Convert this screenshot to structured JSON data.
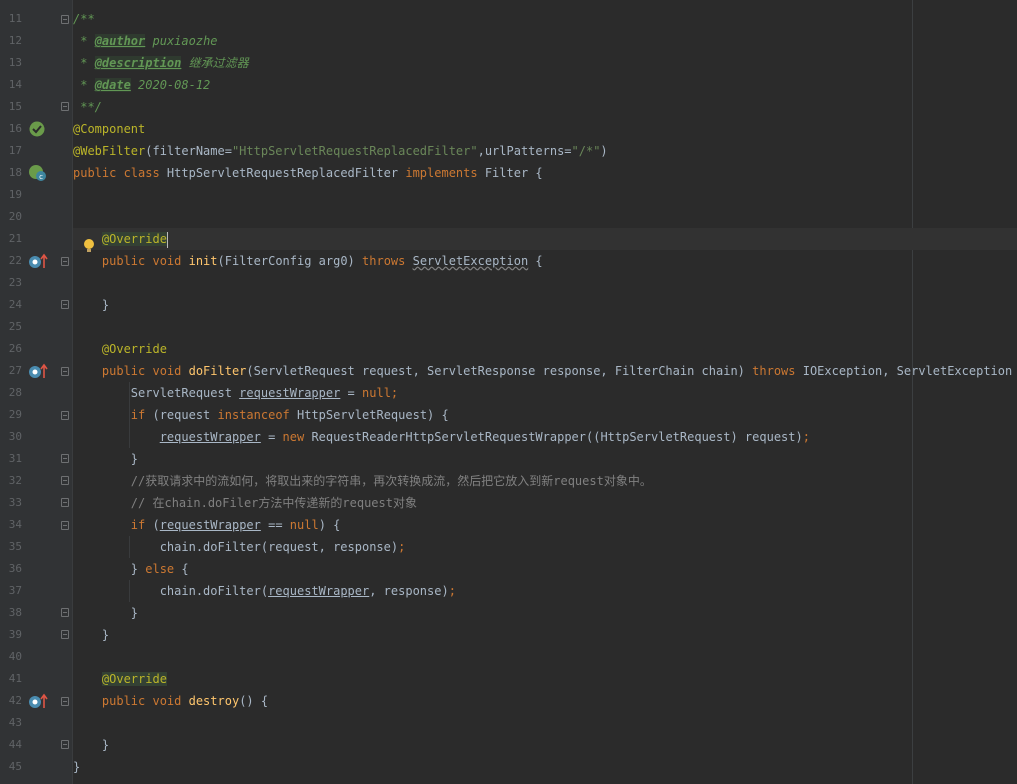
{
  "editor": {
    "lines": [
      {
        "n": "11",
        "t": [
          [
            "doc",
            "/**"
          ]
        ]
      },
      {
        "n": "12",
        "t": [
          [
            "doc",
            " * "
          ],
          [
            "doctag",
            "@author"
          ],
          [
            "doc",
            " puxiaozhe"
          ]
        ]
      },
      {
        "n": "13",
        "t": [
          [
            "doc",
            " * "
          ],
          [
            "doctag",
            "@description"
          ],
          [
            "doc",
            " 继承过滤器"
          ]
        ]
      },
      {
        "n": "14",
        "t": [
          [
            "doc",
            " * "
          ],
          [
            "doctag",
            "@date"
          ],
          [
            "doc",
            " 2020-08-12"
          ]
        ]
      },
      {
        "n": "15",
        "t": [
          [
            "doc",
            " **/"
          ]
        ]
      },
      {
        "n": "16",
        "t": [
          [
            "ann",
            "@Component"
          ]
        ]
      },
      {
        "n": "17",
        "t": [
          [
            "ann",
            "@WebFilter"
          ],
          [
            "plain",
            "(filterName="
          ],
          [
            "str",
            "\"HttpServletRequestReplacedFilter\""
          ],
          [
            "plain",
            ",urlPatterns="
          ],
          [
            "str",
            "\"/*\""
          ],
          [
            "plain",
            ")"
          ]
        ]
      },
      {
        "n": "18",
        "t": [
          [
            "kw",
            "public class "
          ],
          [
            "plain",
            "HttpServletRequestReplacedFilter "
          ],
          [
            "kw",
            "implements "
          ],
          [
            "plain",
            "Filter {"
          ]
        ]
      },
      {
        "n": "19",
        "t": []
      },
      {
        "n": "20",
        "t": []
      },
      {
        "n": "21",
        "t": [
          [
            "plain",
            "    "
          ],
          [
            "ann-hl",
            "@Override"
          ],
          [
            "caret",
            ""
          ]
        ]
      },
      {
        "n": "22",
        "t": [
          [
            "plain",
            "    "
          ],
          [
            "kw",
            "public void "
          ],
          [
            "fn",
            "init"
          ],
          [
            "plain",
            "(FilterConfig arg0) "
          ],
          [
            "kw",
            "throws "
          ],
          [
            "warn",
            "ServletException"
          ],
          [
            "plain",
            " {"
          ]
        ]
      },
      {
        "n": "23",
        "t": []
      },
      {
        "n": "24",
        "t": [
          [
            "plain",
            "    }"
          ]
        ]
      },
      {
        "n": "25",
        "t": []
      },
      {
        "n": "26",
        "t": [
          [
            "plain",
            "    "
          ],
          [
            "ann",
            "@Override"
          ]
        ]
      },
      {
        "n": "27",
        "t": [
          [
            "plain",
            "    "
          ],
          [
            "kw",
            "public void "
          ],
          [
            "fn",
            "doFilter"
          ],
          [
            "plain",
            "(ServletRequest request, ServletResponse response, FilterChain chain) "
          ],
          [
            "kw",
            "throws "
          ],
          [
            "plain",
            "IOException, ServletException {"
          ]
        ]
      },
      {
        "n": "28",
        "t": [
          [
            "plain",
            "        ServletRequest "
          ],
          [
            "var",
            "requestWrapper"
          ],
          [
            "plain",
            " = "
          ],
          [
            "kw",
            "null"
          ],
          [
            "kw",
            ";"
          ]
        ]
      },
      {
        "n": "29",
        "t": [
          [
            "plain",
            "        "
          ],
          [
            "kw",
            "if "
          ],
          [
            "plain",
            "(request "
          ],
          [
            "kw",
            "instanceof "
          ],
          [
            "plain",
            "HttpServletRequest) {"
          ]
        ]
      },
      {
        "n": "30",
        "t": [
          [
            "plain",
            "            "
          ],
          [
            "var",
            "requestWrapper"
          ],
          [
            "plain",
            " = "
          ],
          [
            "kw",
            "new "
          ],
          [
            "plain",
            "RequestReaderHttpServletRequestWrapper((HttpServletRequest) request)"
          ],
          [
            "kw",
            ";"
          ]
        ]
      },
      {
        "n": "31",
        "t": [
          [
            "plain",
            "        }"
          ]
        ]
      },
      {
        "n": "32",
        "t": [
          [
            "plain",
            "        "
          ],
          [
            "cmt",
            "//获取请求中的流如何，将取出来的字符串，再次转换成流，然后把它放入到新request对象中。"
          ]
        ]
      },
      {
        "n": "33",
        "t": [
          [
            "plain",
            "        "
          ],
          [
            "cmt",
            "// 在chain.doFiler方法中传递新的request对象"
          ]
        ]
      },
      {
        "n": "34",
        "t": [
          [
            "plain",
            "        "
          ],
          [
            "kw",
            "if "
          ],
          [
            "plain",
            "("
          ],
          [
            "var",
            "requestWrapper"
          ],
          [
            "plain",
            " == "
          ],
          [
            "kw",
            "null"
          ],
          [
            "plain",
            ") {"
          ]
        ]
      },
      {
        "n": "35",
        "t": [
          [
            "plain",
            "            chain.doFilter(request, response)"
          ],
          [
            "kw",
            ";"
          ]
        ]
      },
      {
        "n": "36",
        "t": [
          [
            "plain",
            "        } "
          ],
          [
            "kw",
            "else "
          ],
          [
            "plain",
            "{"
          ]
        ]
      },
      {
        "n": "37",
        "t": [
          [
            "plain",
            "            chain.doFilter("
          ],
          [
            "var",
            "requestWrapper"
          ],
          [
            "plain",
            ", response)"
          ],
          [
            "kw",
            ";"
          ]
        ]
      },
      {
        "n": "38",
        "t": [
          [
            "plain",
            "        }"
          ]
        ]
      },
      {
        "n": "39",
        "t": [
          [
            "plain",
            "    }"
          ]
        ]
      },
      {
        "n": "40",
        "t": []
      },
      {
        "n": "41",
        "t": [
          [
            "plain",
            "    "
          ],
          [
            "ann-hl",
            "@Override"
          ]
        ]
      },
      {
        "n": "42",
        "t": [
          [
            "plain",
            "    "
          ],
          [
            "kw",
            "public void "
          ],
          [
            "fn",
            "destroy"
          ],
          [
            "plain",
            "() {"
          ]
        ]
      },
      {
        "n": "43",
        "t": []
      },
      {
        "n": "44",
        "t": [
          [
            "plain",
            "    }"
          ]
        ]
      },
      {
        "n": "45",
        "t": [
          [
            "plain",
            "}"
          ]
        ]
      }
    ],
    "colors": {
      "background": "#2b2b2b",
      "gutter": "#313335",
      "keyword": "#cc7832",
      "annotation": "#bbb529",
      "string": "#6a8759",
      "comment": "#808080",
      "doc_comment": "#629755",
      "method": "#ffc66d",
      "text": "#a9b7c6",
      "line_number": "#606366"
    },
    "gutter_icons": {
      "16": "spring-bean-icon",
      "18": "spring-class-icon",
      "21": "intention-bulb-icon",
      "22": "implements-method-icon",
      "27": "implements-method-icon",
      "42": "implements-method-icon"
    }
  }
}
